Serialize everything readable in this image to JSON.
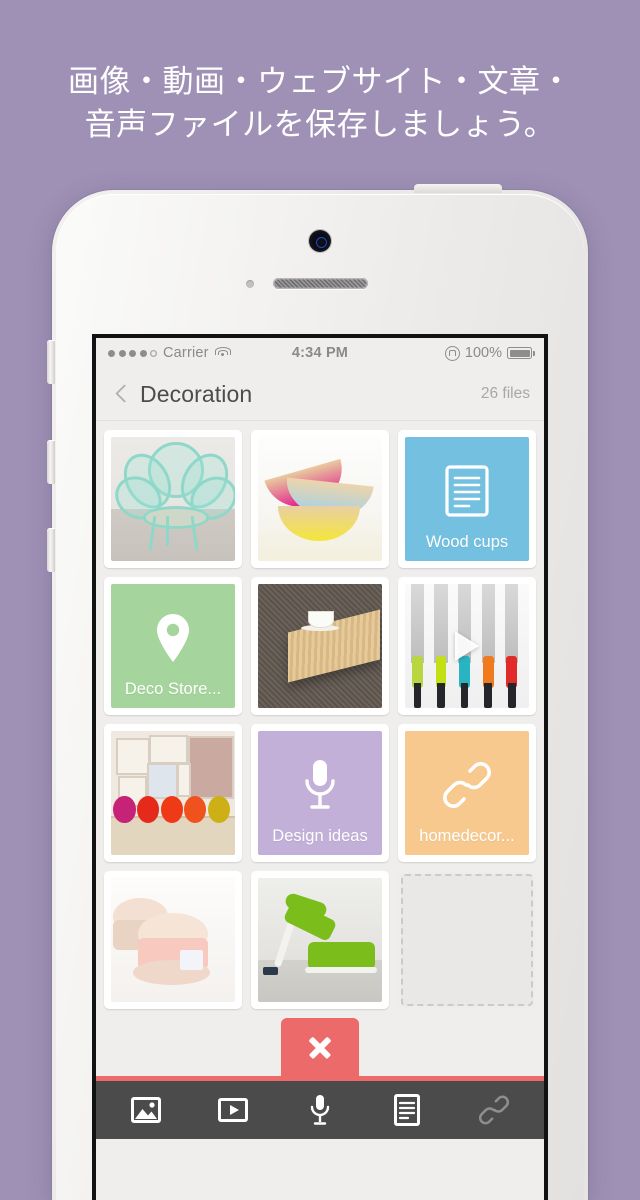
{
  "headline": {
    "line1": "画像・動画・ウェブサイト・文章・",
    "line2": "音声ファイルを保存しましょう。"
  },
  "status_bar": {
    "signal_dots_filled": 4,
    "signal_dots_total": 5,
    "carrier": "Carrier",
    "wifi_icon": "wifi-icon",
    "time": "4:34 PM",
    "rotation_lock_icon": "rotation-lock-icon",
    "battery_percent": "100%",
    "battery_icon": "battery-full-icon"
  },
  "nav_bar": {
    "back_icon": "chevron-left-icon",
    "title": "Decoration",
    "file_count": "26 files"
  },
  "grid": {
    "items": [
      {
        "kind": "photo",
        "art": "chair",
        "label": "",
        "color": ""
      },
      {
        "kind": "photo",
        "art": "bowls",
        "label": "",
        "color": ""
      },
      {
        "kind": "document",
        "art": "",
        "label": "Wood cups",
        "color": "#74c0e0",
        "icon": "document-icon"
      },
      {
        "kind": "location",
        "art": "",
        "label": "Deco Store...",
        "color": "#a5d49c",
        "icon": "map-pin-icon"
      },
      {
        "kind": "photo",
        "art": "tray",
        "label": "",
        "color": ""
      },
      {
        "kind": "video",
        "art": "knives",
        "label": "",
        "color": "",
        "icon": "play-icon"
      },
      {
        "kind": "photo",
        "art": "gallery",
        "label": "",
        "color": ""
      },
      {
        "kind": "audio",
        "art": "",
        "label": "Design ideas",
        "color": "#c2b0d8",
        "icon": "microphone-icon"
      },
      {
        "kind": "link",
        "art": "",
        "label": "homedecor...",
        "color": "#f7c98f",
        "icon": "link-icon"
      },
      {
        "kind": "photo",
        "art": "cookie",
        "label": "",
        "color": ""
      },
      {
        "kind": "photo",
        "art": "futon",
        "label": "",
        "color": ""
      },
      {
        "kind": "empty",
        "art": "",
        "label": "",
        "color": ""
      }
    ]
  },
  "close_button": {
    "icon": "close-x-icon",
    "color": "#ec6a6a"
  },
  "toolbar": {
    "background": "#4b4b4b",
    "items": [
      {
        "icon": "image-icon",
        "active": true
      },
      {
        "icon": "video-icon",
        "active": true
      },
      {
        "icon": "microphone-icon",
        "active": true
      },
      {
        "icon": "document-icon",
        "active": true
      },
      {
        "icon": "link-icon",
        "active": false
      }
    ]
  },
  "theme": {
    "background": "#9e91b5",
    "screen_bg": "#efeeec",
    "accent_red": "#ec6a6a"
  }
}
